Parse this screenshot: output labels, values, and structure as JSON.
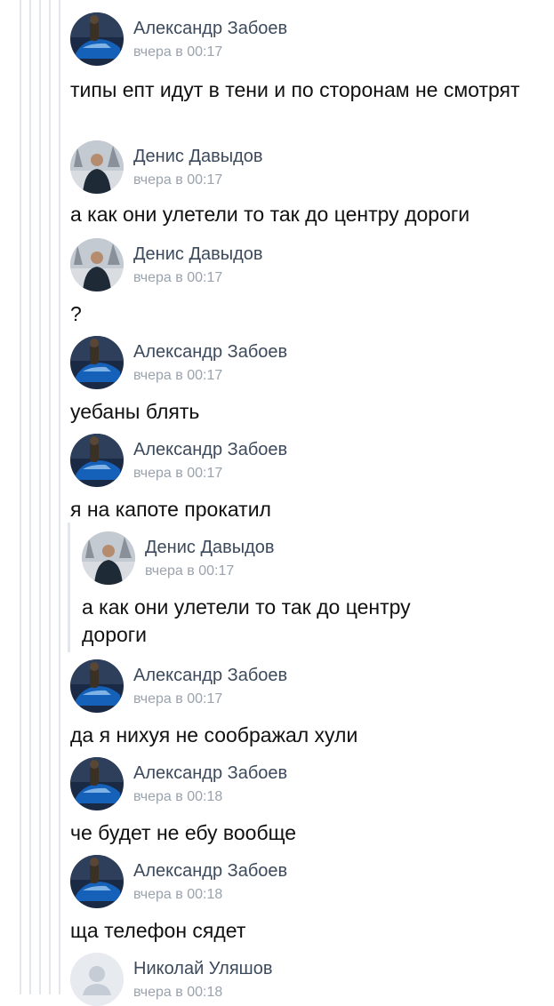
{
  "colors": {
    "author": "#3d4a5c",
    "time": "#9aa3ad",
    "text": "#111111",
    "thread_line": "#e3e6ea"
  },
  "messages": [
    {
      "author": "Александр Забоев",
      "time": "вчера в 00:17",
      "text": "типы епт идут в тени и по сторонам не смотрят",
      "avatar": "avatar-car"
    },
    {
      "author": "Денис Давыдов",
      "time": "вчера в 00:17",
      "text": "а как они улетели то так до центру дороги",
      "avatar": "avatar-person"
    },
    {
      "author": "Денис Давыдов",
      "time": "вчера в 00:17",
      "text": "?",
      "avatar": "avatar-person"
    },
    {
      "author": "Александр Забоев",
      "time": "вчера в 00:17",
      "text": "уебаны блять",
      "avatar": "avatar-car"
    },
    {
      "author": "Александр Забоев",
      "time": "вчера в 00:17",
      "text": "я на капоте прокатил",
      "avatar": "avatar-car"
    },
    {
      "author": "Денис Давыдов",
      "time": "вчера в 00:17",
      "text": "а как они улетели то так до центру дороги",
      "avatar": "avatar-person"
    },
    {
      "author": "Александр Забоев",
      "time": "вчера в 00:17",
      "text": "да я нихуя не соображал хули",
      "avatar": "avatar-car"
    },
    {
      "author": "Александр Забоев",
      "time": "вчера в 00:18",
      "text": "че будет не ебу вообще",
      "avatar": "avatar-car"
    },
    {
      "author": "Александр Забоев",
      "time": "вчера в 00:18",
      "text": "ща телефон сядет",
      "avatar": "avatar-car"
    },
    {
      "author": "Николай Уляшов",
      "time": "вчера в 00:18",
      "text": "",
      "avatar": "avatar-placeholder"
    }
  ]
}
